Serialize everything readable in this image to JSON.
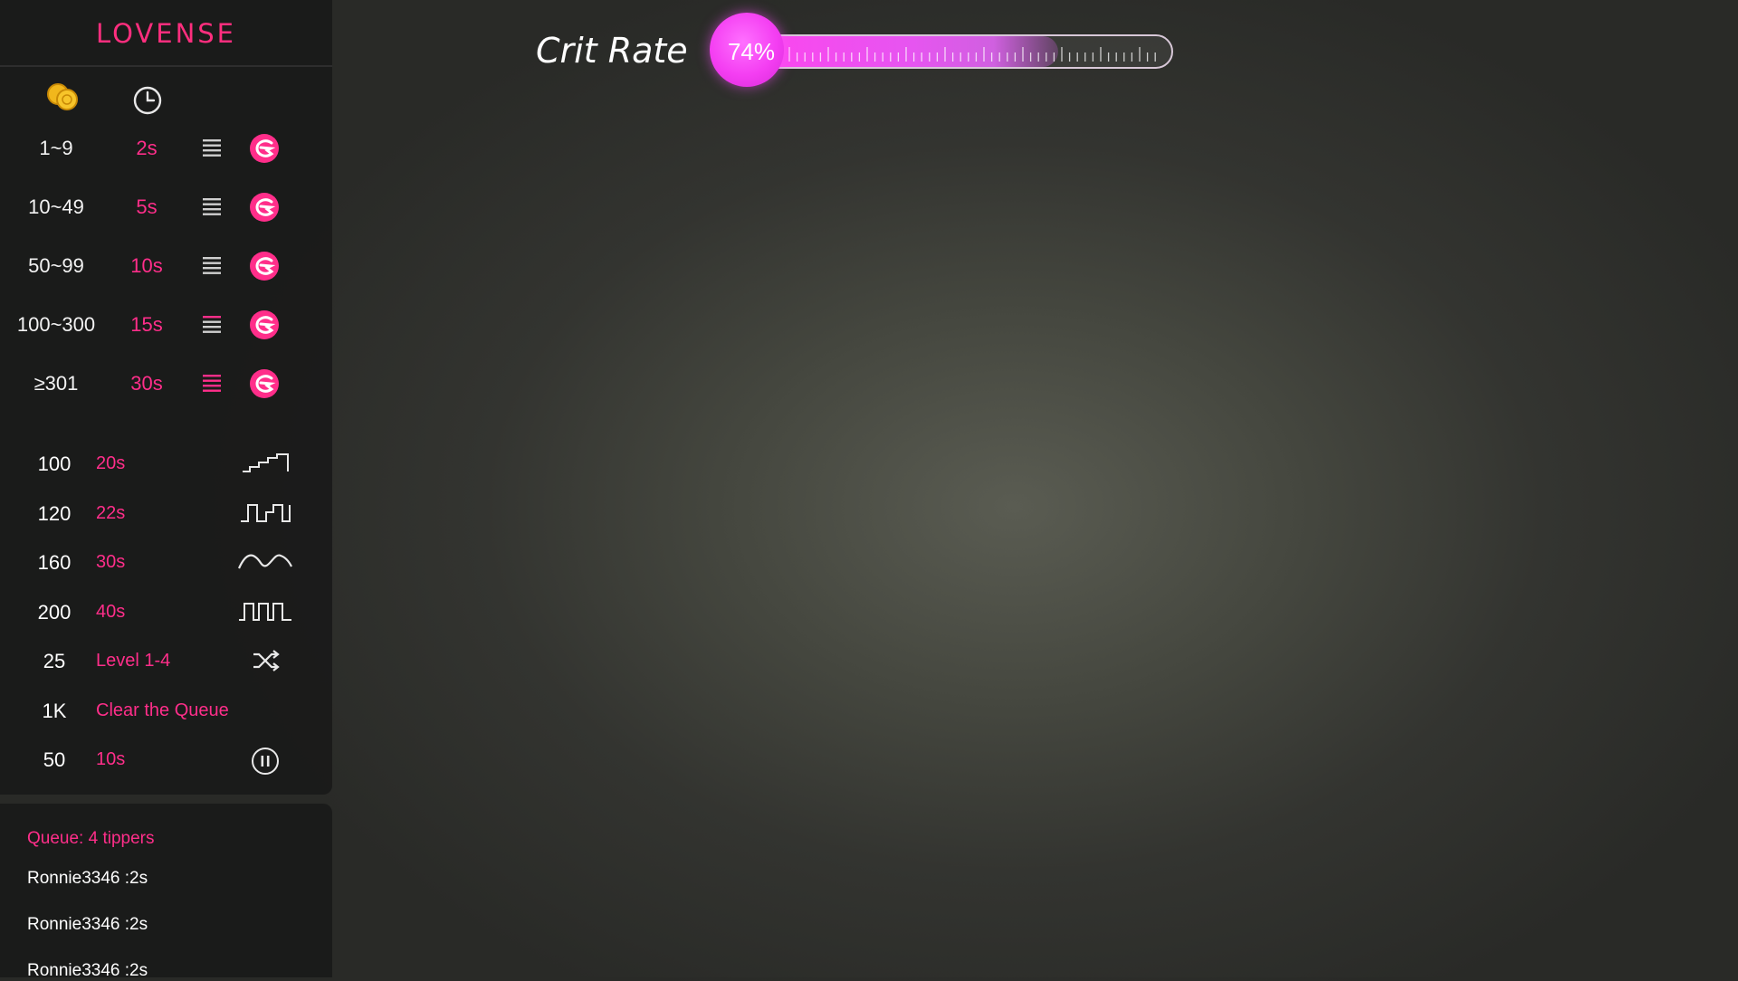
{
  "brand": {
    "name": "LOVENSE",
    "accent": "#ff2e8a"
  },
  "header_icons": [
    "coins-icon",
    "clock-icon"
  ],
  "tip_levels": [
    {
      "range": "1~9",
      "duration": "2s"
    },
    {
      "range": "10~49",
      "duration": "5s"
    },
    {
      "range": "50~99",
      "duration": "10s"
    },
    {
      "range": "100~300",
      "duration": "15s"
    },
    {
      "range": "≥301",
      "duration": "30s"
    }
  ],
  "special_commands": [
    {
      "amount": "100",
      "label": "20s",
      "icon": "stairs-pattern-icon"
    },
    {
      "amount": "120",
      "label": "22s",
      "icon": "pulse-pattern-icon"
    },
    {
      "amount": "160",
      "label": "30s",
      "icon": "wave-pattern-icon"
    },
    {
      "amount": "200",
      "label": "40s",
      "icon": "square-wave-pattern-icon"
    },
    {
      "amount": "25",
      "label": "Level 1-4",
      "icon": "shuffle-icon"
    },
    {
      "amount": "1K",
      "label": "Clear the Queue",
      "icon": ""
    },
    {
      "amount": "50",
      "label": "10s",
      "icon": "pause-icon"
    }
  ],
  "queue": {
    "title": "Queue: 4 tippers",
    "items": [
      "Ronnie3346 :2s",
      "Ronnie3346 :2s",
      "Ronnie3346 :2s"
    ]
  },
  "crit_rate": {
    "label": "Crit Rate",
    "value_text": "74%",
    "fraction": 0.74,
    "color": "#f43ef2"
  }
}
